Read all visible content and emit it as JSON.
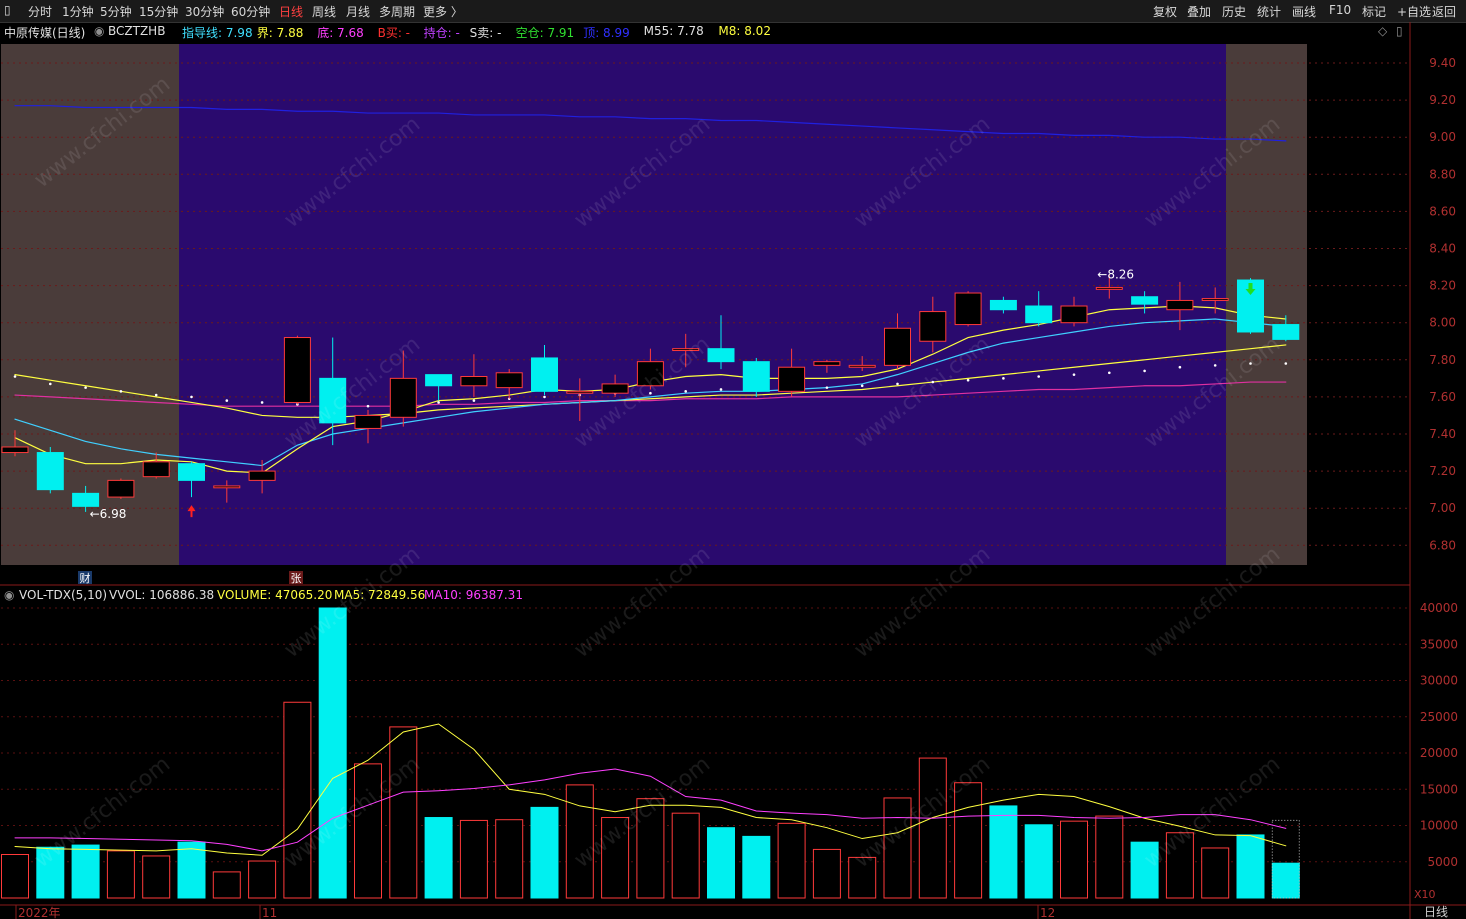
{
  "toolbar": {
    "periods": [
      "分时",
      "1分钟",
      "5分钟",
      "15分钟",
      "30分钟",
      "60分钟",
      "日线",
      "周线",
      "月线",
      "多周期",
      "更多 〉"
    ],
    "active": "日线",
    "right": [
      "复权",
      "叠加",
      "历史",
      "统计",
      "画线",
      "F10",
      "标记",
      "+自选",
      "返回"
    ]
  },
  "header": {
    "stock": "中原传媒(日线)",
    "indicator": "BCZTZHB",
    "fields": [
      {
        "label": "指导线:",
        "value": "7.98",
        "color": "#40e0ff"
      },
      {
        "label": "界:",
        "value": "7.88",
        "color": "#ffff40"
      },
      {
        "label": "底:",
        "value": "7.68",
        "color": "#ff40ff"
      },
      {
        "label": "B买:",
        "value": "-",
        "color": "#ff3030"
      },
      {
        "label": "持仓:",
        "value": "-",
        "color": "#c040ff"
      },
      {
        "label": "S卖:",
        "value": "-",
        "color": "#e0e0e0"
      },
      {
        "label": "空仓:",
        "value": "7.91",
        "color": "#30e030"
      },
      {
        "label": "顶:",
        "value": "8.99",
        "color": "#3030ff"
      },
      {
        "label": "M55:",
        "value": "7.78",
        "color": "#e0e0e0"
      },
      {
        "label": "M8:",
        "value": "8.02",
        "color": "#ffff40"
      }
    ]
  },
  "vol_header": {
    "name": "VOL-TDX(5,10)",
    "vvol": "VVOL: 106886.38",
    "volume": "VOLUME: 47065.20",
    "ma5": "MA5: 72849.56",
    "ma10": "MA10: 96387.31"
  },
  "markers": {
    "low_label": "6.98",
    "high_label": "8.26",
    "cai": "财",
    "zhang": "张"
  },
  "axis_labels": {
    "x10": "X10",
    "period": "日线"
  },
  "watermark": "www.cfchi.com",
  "chart_data": [
    {
      "type": "candlestick",
      "ylim": [
        6.7,
        9.55
      ],
      "yticks": [
        "9.40",
        "9.20",
        "9.00",
        "8.80",
        "8.60",
        "8.40",
        "8.20",
        "8.00",
        "7.80",
        "7.60",
        "7.40",
        "7.20",
        "7.00",
        "6.80"
      ],
      "dates": [
        "2022年",
        "11",
        "12"
      ],
      "candles": [
        {
          "o": 7.3,
          "c": 7.33,
          "h": 7.42,
          "l": 7.28
        },
        {
          "o": 7.3,
          "c": 7.1,
          "h": 7.33,
          "l": 7.08
        },
        {
          "o": 7.08,
          "c": 7.01,
          "h": 7.12,
          "l": 6.98
        },
        {
          "o": 7.06,
          "c": 7.15,
          "h": 7.16,
          "l": 7.05
        },
        {
          "o": 7.17,
          "c": 7.25,
          "h": 7.3,
          "l": 7.16
        },
        {
          "o": 7.24,
          "c": 7.15,
          "h": 7.25,
          "l": 7.06
        },
        {
          "o": 7.11,
          "c": 7.12,
          "h": 7.15,
          "l": 7.03
        },
        {
          "o": 7.15,
          "c": 7.2,
          "h": 7.26,
          "l": 7.08
        },
        {
          "o": 7.57,
          "c": 7.92,
          "h": 7.93,
          "l": 7.56
        },
        {
          "o": 7.7,
          "c": 7.46,
          "h": 7.92,
          "l": 7.34
        },
        {
          "o": 7.43,
          "c": 7.5,
          "h": 7.53,
          "l": 7.35
        },
        {
          "o": 7.49,
          "c": 7.7,
          "h": 7.85,
          "l": 7.44
        },
        {
          "o": 7.72,
          "c": 7.66,
          "h": 7.72,
          "l": 7.58
        },
        {
          "o": 7.66,
          "c": 7.71,
          "h": 7.83,
          "l": 7.6
        },
        {
          "o": 7.65,
          "c": 7.73,
          "h": 7.75,
          "l": 7.59
        },
        {
          "o": 7.81,
          "c": 7.63,
          "h": 7.88,
          "l": 7.61
        },
        {
          "o": 7.62,
          "c": 7.63,
          "h": 7.7,
          "l": 7.47
        },
        {
          "o": 7.62,
          "c": 7.67,
          "h": 7.72,
          "l": 7.6
        },
        {
          "o": 7.66,
          "c": 7.79,
          "h": 7.86,
          "l": 7.64
        },
        {
          "o": 7.85,
          "c": 7.86,
          "h": 7.94,
          "l": 7.76
        },
        {
          "o": 7.86,
          "c": 7.79,
          "h": 8.04,
          "l": 7.75
        },
        {
          "o": 7.79,
          "c": 7.63,
          "h": 7.81,
          "l": 7.6
        },
        {
          "o": 7.63,
          "c": 7.76,
          "h": 7.86,
          "l": 7.6
        },
        {
          "o": 7.77,
          "c": 7.79,
          "h": 7.8,
          "l": 7.73
        },
        {
          "o": 7.76,
          "c": 7.77,
          "h": 7.82,
          "l": 7.74
        },
        {
          "o": 7.77,
          "c": 7.97,
          "h": 8.05,
          "l": 7.75
        },
        {
          "o": 7.9,
          "c": 8.06,
          "h": 8.14,
          "l": 7.84
        },
        {
          "o": 7.99,
          "c": 8.16,
          "h": 8.17,
          "l": 7.98
        },
        {
          "o": 8.12,
          "c": 8.07,
          "h": 8.14,
          "l": 8.05
        },
        {
          "o": 8.09,
          "c": 8.0,
          "h": 8.17,
          "l": 7.98
        },
        {
          "o": 8.0,
          "c": 8.09,
          "h": 8.14,
          "l": 7.98
        },
        {
          "o": 8.18,
          "c": 8.19,
          "h": 8.26,
          "l": 8.13
        },
        {
          "o": 8.14,
          "c": 8.1,
          "h": 8.17,
          "l": 8.05
        },
        {
          "o": 8.07,
          "c": 8.12,
          "h": 8.22,
          "l": 7.96
        },
        {
          "o": 8.12,
          "c": 8.13,
          "h": 8.19,
          "l": 8.05
        },
        {
          "o": 8.23,
          "c": 7.95,
          "h": 8.24,
          "l": 7.94
        },
        {
          "o": 7.99,
          "c": 7.91,
          "h": 8.04,
          "l": 7.9
        }
      ],
      "lines": {
        "ding": [
          9.17,
          9.17,
          9.16,
          9.16,
          9.16,
          9.16,
          9.15,
          9.15,
          9.14,
          9.14,
          9.13,
          9.13,
          9.13,
          9.12,
          9.12,
          9.12,
          9.11,
          9.11,
          9.1,
          9.1,
          9.09,
          9.09,
          9.08,
          9.07,
          9.06,
          9.05,
          9.04,
          9.03,
          9.02,
          9.02,
          9.01,
          9.01,
          9.0,
          9.0,
          8.99,
          8.99,
          8.98
        ],
        "di": [
          7.61,
          7.6,
          7.59,
          7.58,
          7.57,
          7.56,
          7.55,
          7.55,
          7.55,
          7.55,
          7.55,
          7.55,
          7.56,
          7.56,
          7.57,
          7.57,
          7.58,
          7.58,
          7.58,
          7.59,
          7.59,
          7.59,
          7.6,
          7.6,
          7.6,
          7.6,
          7.61,
          7.62,
          7.63,
          7.64,
          7.64,
          7.65,
          7.66,
          7.66,
          7.67,
          7.68,
          7.68
        ],
        "jie": [
          7.72,
          7.69,
          7.66,
          7.63,
          7.6,
          7.57,
          7.54,
          7.5,
          7.49,
          7.49,
          7.5,
          7.51,
          7.53,
          7.54,
          7.55,
          7.56,
          7.57,
          7.58,
          7.59,
          7.6,
          7.61,
          7.61,
          7.62,
          7.63,
          7.64,
          7.66,
          7.68,
          7.7,
          7.72,
          7.74,
          7.76,
          7.78,
          7.8,
          7.82,
          7.84,
          7.86,
          7.88
        ],
        "zhidao": [
          7.48,
          7.42,
          7.36,
          7.32,
          7.29,
          7.27,
          7.25,
          7.23,
          7.34,
          7.4,
          7.43,
          7.46,
          7.49,
          7.52,
          7.54,
          7.56,
          7.57,
          7.58,
          7.6,
          7.62,
          7.63,
          7.63,
          7.64,
          7.65,
          7.67,
          7.72,
          7.78,
          7.84,
          7.89,
          7.92,
          7.95,
          7.98,
          8.0,
          8.01,
          8.02,
          8.0,
          7.98
        ],
        "m8": [
          7.38,
          7.29,
          7.24,
          7.24,
          7.26,
          7.25,
          7.2,
          7.19,
          7.32,
          7.44,
          7.47,
          7.52,
          7.58,
          7.59,
          7.61,
          7.64,
          7.63,
          7.64,
          7.68,
          7.71,
          7.72,
          7.7,
          7.7,
          7.7,
          7.71,
          7.75,
          7.83,
          7.92,
          7.96,
          7.99,
          8.03,
          8.07,
          8.08,
          8.09,
          8.08,
          8.04,
          8.02
        ],
        "m55": [
          7.71,
          7.67,
          7.65,
          7.63,
          7.61,
          7.6,
          7.58,
          7.57,
          7.56,
          7.55,
          7.55,
          7.56,
          7.57,
          7.58,
          7.59,
          7.6,
          7.61,
          7.62,
          7.62,
          7.63,
          7.64,
          7.64,
          7.65,
          7.65,
          7.66,
          7.67,
          7.68,
          7.69,
          7.7,
          7.71,
          7.72,
          7.73,
          7.74,
          7.76,
          7.77,
          7.78,
          7.78
        ]
      }
    },
    {
      "type": "bar",
      "name": "VOL-TDX(5,10)",
      "ylim": [
        0,
        41000
      ],
      "yticks": [
        "40000",
        "35000",
        "30000",
        "25000",
        "20000",
        "15000",
        "10000",
        "5000"
      ],
      "volumes": [
        6000,
        7000,
        7300,
        6500,
        5800,
        7700,
        3600,
        5100,
        27000,
        40000,
        18500,
        23600,
        11100,
        10700,
        10800,
        12500,
        15600,
        11100,
        13700,
        11700,
        9700,
        8500,
        10300,
        6700,
        5600,
        13800,
        19300,
        15900,
        12700,
        10100,
        10600,
        11300,
        7700,
        9000,
        6900,
        8700,
        4800
      ],
      "ma5": [
        7100,
        6800,
        6700,
        6600,
        6500,
        6800,
        6200,
        5900,
        9500,
        16500,
        19000,
        22900,
        24000,
        20500,
        15000,
        14300,
        12700,
        11900,
        12800,
        12800,
        12500,
        11100,
        10800,
        9700,
        8200,
        9000,
        11100,
        12500,
        13500,
        14300,
        14000,
        12600,
        11000,
        9900,
        8700,
        8600,
        7200
      ],
      "ma10": [
        8300,
        8300,
        8200,
        8100,
        8000,
        7900,
        7400,
        6500,
        7700,
        11000,
        12800,
        14600,
        14800,
        15100,
        15600,
        16300,
        17200,
        17800,
        16800,
        14000,
        13500,
        12000,
        11700,
        11500,
        11000,
        11100,
        11000,
        11300,
        11400,
        11400,
        11100,
        11000,
        11100,
        11500,
        11500,
        10800,
        9600
      ]
    }
  ]
}
